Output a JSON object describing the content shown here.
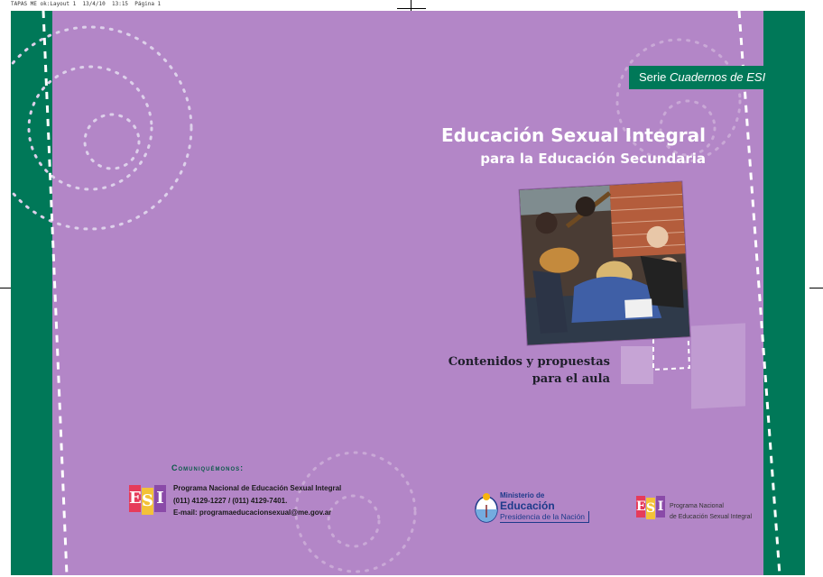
{
  "slug": "TAPAS ME ok:Layout 1  13/4/10  13:15  Página 1",
  "series_badge": {
    "prefix": "Serie ",
    "name": "Cuadernos de ESI"
  },
  "title": {
    "main": "Educación Sexual Integral",
    "sub": "para la Educación Secundaria"
  },
  "subtitle": {
    "line1": "Contenidos y propuestas",
    "line2": "para el aula"
  },
  "contact": {
    "heading": "Comuniquémonos:",
    "program": "Programa Nacional de Educación Sexual Integral",
    "phones": "(011) 4129-1227 /  (011) 4129-7401.",
    "email": "E-mail: programaeducacionsexual@me.gov.ar"
  },
  "esi_logo": {
    "letters": [
      "E",
      "S",
      "I"
    ],
    "colors": [
      "#e63b5a",
      "#f3c238",
      "#8a4aa8"
    ]
  },
  "ministry": {
    "line1": "Ministerio de",
    "line2": "Educación",
    "line3": "Presidencia de la Nación"
  },
  "program_logo": {
    "line1": "Programa Nacional",
    "line2": "de Educación Sexual Integral"
  },
  "colors": {
    "background": "#b386c7",
    "band": "#007858",
    "title": "#ffffff"
  },
  "photo": {
    "description_icon": "students-playing-guitar-photo"
  }
}
